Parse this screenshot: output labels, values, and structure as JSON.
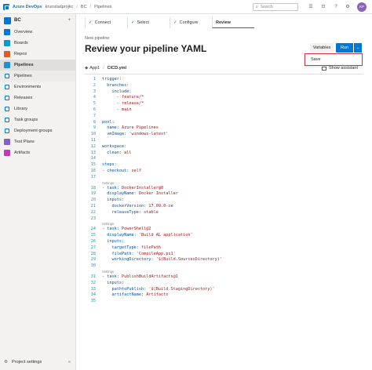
{
  "topbar": {
    "brand": "Azure DevOps",
    "org": "krunstadprojkc",
    "project": "BC",
    "section": "Pipelines",
    "separator": "/",
    "search_placeholder": "Search",
    "avatar_initials": "KP"
  },
  "sidebar": {
    "project_name": "BC",
    "add_label": "+",
    "items": [
      {
        "label": "Overview",
        "color": "#0078d4"
      },
      {
        "label": "Boards",
        "color": "#009ccc"
      },
      {
        "label": "Repos",
        "color": "#e05b26"
      },
      {
        "label": "Pipelines",
        "color": "#1e90d8"
      }
    ],
    "sub_items": [
      "Pipelines",
      "Environments",
      "Releases",
      "Library",
      "Task groups",
      "Deployment groups"
    ],
    "more_items": [
      {
        "label": "Test Plans",
        "color": "#8661c5"
      },
      {
        "label": "Artifacts",
        "color": "#c239b3"
      }
    ],
    "footer": "Project settings",
    "footer_chevron": "«"
  },
  "wizard": {
    "tabs": [
      {
        "label": "Connect",
        "done": "✓"
      },
      {
        "label": "Select",
        "done": "✓"
      },
      {
        "label": "Configure",
        "done": "✓"
      },
      {
        "label": "Review",
        "done": ""
      }
    ]
  },
  "header": {
    "eyebrow": "New pipeline",
    "title": "Review your pipeline YAML",
    "variables_button": "Variables",
    "run_button": "Run",
    "dropdown_chevron": "⌄",
    "menu_item": "Save"
  },
  "file": {
    "repo": "App1",
    "separator": "/",
    "filename": "CICD.yml",
    "show_assistant": "Show assistant"
  },
  "editor": {
    "settings_label": "Settings",
    "lines": [
      {
        "n": "1",
        "t": "trigger:"
      },
      {
        "n": "2",
        "t": "  branches:"
      },
      {
        "n": "3",
        "t": "    include:"
      },
      {
        "n": "4",
        "t": "      - feature/*"
      },
      {
        "n": "5",
        "t": "      - release/*"
      },
      {
        "n": "6",
        "t": "      - main"
      },
      {
        "n": "7",
        "t": ""
      },
      {
        "n": "8",
        "t": "pool:"
      },
      {
        "n": "9",
        "t": "  name: Azure Pipelines"
      },
      {
        "n": "10",
        "t": "  vmImage: 'windows-latest'"
      },
      {
        "n": "11",
        "t": ""
      },
      {
        "n": "12",
        "t": "workspace:"
      },
      {
        "n": "13",
        "t": "  clean: all"
      },
      {
        "n": "14",
        "t": ""
      },
      {
        "n": "15",
        "t": "steps:"
      },
      {
        "n": "16",
        "t": "- checkout: self"
      },
      {
        "n": "17",
        "t": ""
      },
      {
        "n": "18",
        "t": "- task: DockerInstaller@0",
        "settings": true
      },
      {
        "n": "19",
        "t": "  displayName: Docker Installer"
      },
      {
        "n": "20",
        "t": "  inputs:"
      },
      {
        "n": "21",
        "t": "    dockerVersion: 17.09.0-ce"
      },
      {
        "n": "22",
        "t": "    releaseType: stable"
      },
      {
        "n": "23",
        "t": ""
      },
      {
        "n": "24",
        "t": "- task: PowerShell@2",
        "settings": true
      },
      {
        "n": "25",
        "t": "  displayName: 'Build AL application'"
      },
      {
        "n": "26",
        "t": "  inputs:"
      },
      {
        "n": "27",
        "t": "    targetType: filePath"
      },
      {
        "n": "28",
        "t": "    filePath: 'CompileApp.ps1'"
      },
      {
        "n": "29",
        "t": "    workingDirectory: '$(Build.SourcesDirectory)'"
      },
      {
        "n": "30",
        "t": ""
      },
      {
        "n": "31",
        "t": "- task: PublishBuildArtifacts@1",
        "settings": true
      },
      {
        "n": "32",
        "t": "  inputs:"
      },
      {
        "n": "33",
        "t": "    pathtoPublish: '$(Build.StagingDirectory)'"
      },
      {
        "n": "34",
        "t": "    artifactName: Artifacts"
      },
      {
        "n": "35",
        "t": ""
      }
    ]
  }
}
